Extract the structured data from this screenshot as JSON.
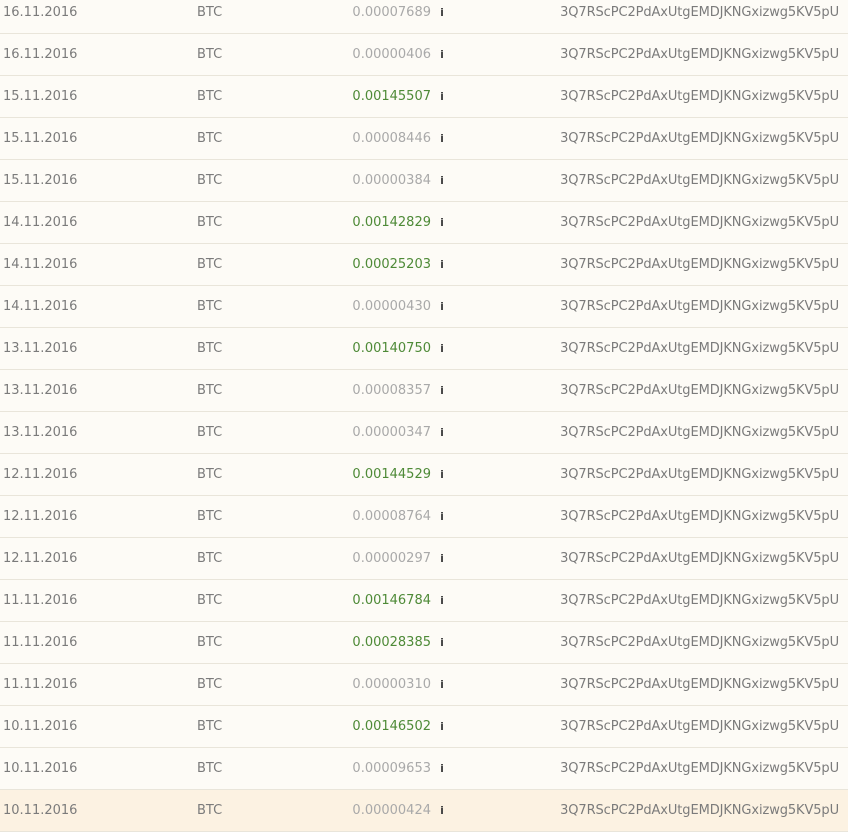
{
  "colors": {
    "background": "#fdfbf6",
    "highlight_row": "#fcf2e2",
    "text": "#7b7b7b",
    "amount_muted": "#a9a9a9",
    "amount_green": "#4e8a37"
  },
  "rows": [
    {
      "date": "16.11.2016",
      "currency": "BTC",
      "amount": "0.00007689",
      "status": "muted",
      "info_icon": "i",
      "address": "3Q7RScPC2PdAxUtgEMDJKNGxizwg5KV5pU"
    },
    {
      "date": "16.11.2016",
      "currency": "BTC",
      "amount": "0.00000406",
      "status": "muted",
      "info_icon": "i",
      "address": "3Q7RScPC2PdAxUtgEMDJKNGxizwg5KV5pU"
    },
    {
      "date": "15.11.2016",
      "currency": "BTC",
      "amount": "0.00145507",
      "status": "green",
      "info_icon": "i",
      "address": "3Q7RScPC2PdAxUtgEMDJKNGxizwg5KV5pU"
    },
    {
      "date": "15.11.2016",
      "currency": "BTC",
      "amount": "0.00008446",
      "status": "muted",
      "info_icon": "i",
      "address": "3Q7RScPC2PdAxUtgEMDJKNGxizwg5KV5pU"
    },
    {
      "date": "15.11.2016",
      "currency": "BTC",
      "amount": "0.00000384",
      "status": "muted",
      "info_icon": "i",
      "address": "3Q7RScPC2PdAxUtgEMDJKNGxizwg5KV5pU"
    },
    {
      "date": "14.11.2016",
      "currency": "BTC",
      "amount": "0.00142829",
      "status": "green",
      "info_icon": "i",
      "address": "3Q7RScPC2PdAxUtgEMDJKNGxizwg5KV5pU"
    },
    {
      "date": "14.11.2016",
      "currency": "BTC",
      "amount": "0.00025203",
      "status": "green",
      "info_icon": "i",
      "address": "3Q7RScPC2PdAxUtgEMDJKNGxizwg5KV5pU"
    },
    {
      "date": "14.11.2016",
      "currency": "BTC",
      "amount": "0.00000430",
      "status": "muted",
      "info_icon": "i",
      "address": "3Q7RScPC2PdAxUtgEMDJKNGxizwg5KV5pU"
    },
    {
      "date": "13.11.2016",
      "currency": "BTC",
      "amount": "0.00140750",
      "status": "green",
      "info_icon": "i",
      "address": "3Q7RScPC2PdAxUtgEMDJKNGxizwg5KV5pU"
    },
    {
      "date": "13.11.2016",
      "currency": "BTC",
      "amount": "0.00008357",
      "status": "muted",
      "info_icon": "i",
      "address": "3Q7RScPC2PdAxUtgEMDJKNGxizwg5KV5pU"
    },
    {
      "date": "13.11.2016",
      "currency": "BTC",
      "amount": "0.00000347",
      "status": "muted",
      "info_icon": "i",
      "address": "3Q7RScPC2PdAxUtgEMDJKNGxizwg5KV5pU"
    },
    {
      "date": "12.11.2016",
      "currency": "BTC",
      "amount": "0.00144529",
      "status": "green",
      "info_icon": "i",
      "address": "3Q7RScPC2PdAxUtgEMDJKNGxizwg5KV5pU"
    },
    {
      "date": "12.11.2016",
      "currency": "BTC",
      "amount": "0.00008764",
      "status": "muted",
      "info_icon": "i",
      "address": "3Q7RScPC2PdAxUtgEMDJKNGxizwg5KV5pU"
    },
    {
      "date": "12.11.2016",
      "currency": "BTC",
      "amount": "0.00000297",
      "status": "muted",
      "info_icon": "i",
      "address": "3Q7RScPC2PdAxUtgEMDJKNGxizwg5KV5pU"
    },
    {
      "date": "11.11.2016",
      "currency": "BTC",
      "amount": "0.00146784",
      "status": "green",
      "info_icon": "i",
      "address": "3Q7RScPC2PdAxUtgEMDJKNGxizwg5KV5pU"
    },
    {
      "date": "11.11.2016",
      "currency": "BTC",
      "amount": "0.00028385",
      "status": "green",
      "info_icon": "i",
      "address": "3Q7RScPC2PdAxUtgEMDJKNGxizwg5KV5pU"
    },
    {
      "date": "11.11.2016",
      "currency": "BTC",
      "amount": "0.00000310",
      "status": "muted",
      "info_icon": "i",
      "address": "3Q7RScPC2PdAxUtgEMDJKNGxizwg5KV5pU"
    },
    {
      "date": "10.11.2016",
      "currency": "BTC",
      "amount": "0.00146502",
      "status": "green",
      "info_icon": "i",
      "address": "3Q7RScPC2PdAxUtgEMDJKNGxizwg5KV5pU"
    },
    {
      "date": "10.11.2016",
      "currency": "BTC",
      "amount": "0.00009653",
      "status": "muted",
      "info_icon": "i",
      "address": "3Q7RScPC2PdAxUtgEMDJKNGxizwg5KV5pU"
    },
    {
      "date": "10.11.2016",
      "currency": "BTC",
      "amount": "0.00000424",
      "status": "muted",
      "info_icon": "i",
      "address": "3Q7RScPC2PdAxUtgEMDJKNGxizwg5KV5pU",
      "highlighted": true
    }
  ]
}
